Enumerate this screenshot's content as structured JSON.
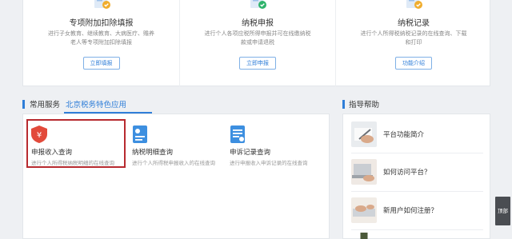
{
  "top_cards": [
    {
      "icon": "certificate-check-icon",
      "title": "专项附加扣除填报",
      "desc": "进行子女教育、继续教育、大病医疗、赡养老人等专项附加扣除填报",
      "button": "立即填报"
    },
    {
      "icon": "certificate-check-icon",
      "title": "纳税申报",
      "desc": "进行个人各项应税所得申报并可在线缴纳税款或申请退税",
      "button": "立即申报"
    },
    {
      "icon": "certificate-check-icon",
      "title": "纳税记录",
      "desc": "进行个人所得税纳税记录的在线查询、下载和打印",
      "button": "功能介绍"
    }
  ],
  "tabs": {
    "common": "常用服务",
    "beijing": "北京税务特色应用"
  },
  "services": [
    {
      "icon": "yuan-shield-icon",
      "title": "申报收入查询",
      "desc": "进行个人所得税纳税明细的在线查询"
    },
    {
      "icon": "document-list-icon",
      "title": "纳税明细查询",
      "desc": "进行个人所得税申报收入的在线查询"
    },
    {
      "icon": "appeal-document-icon",
      "title": "申诉记录查询",
      "desc": "进行申报收入申诉记录的在线查询"
    }
  ],
  "help": {
    "title": "指导帮助",
    "items": [
      {
        "label": "平台功能简介",
        "icon": "hand-pen-thumbnail"
      },
      {
        "label": "如何访问平台？",
        "icon": "laptop-typing-thumbnail"
      },
      {
        "label": "新用户如何注册？",
        "icon": "keyboard-thumbnail"
      }
    ]
  },
  "float_button": "顶部",
  "colors": {
    "accent": "#2f7ed8",
    "highlight_border": "#b72a2f",
    "service_icon_red": "#e24a3b",
    "service_icon_blue": "#3d8fe0"
  }
}
